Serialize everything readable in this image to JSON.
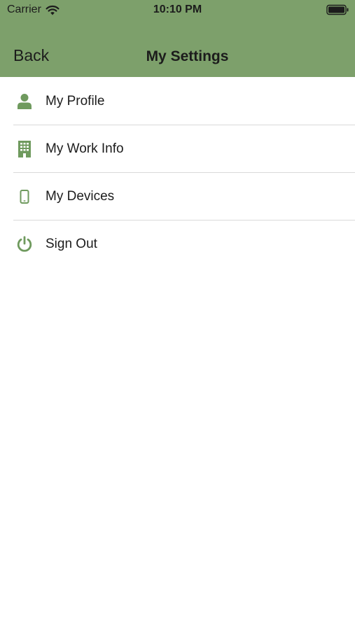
{
  "status_bar": {
    "carrier": "Carrier",
    "time": "10:10 PM"
  },
  "nav": {
    "back_label": "Back",
    "title": "My Settings"
  },
  "menu": {
    "items": [
      {
        "label": "My Profile",
        "icon": "person-icon"
      },
      {
        "label": "My Work Info",
        "icon": "building-icon"
      },
      {
        "label": "My Devices",
        "icon": "phone-icon"
      },
      {
        "label": "Sign Out",
        "icon": "power-icon"
      }
    ]
  },
  "colors": {
    "accent": "#7da06b",
    "icon": "#6f9a5e",
    "divider": "#d9d9d9"
  }
}
